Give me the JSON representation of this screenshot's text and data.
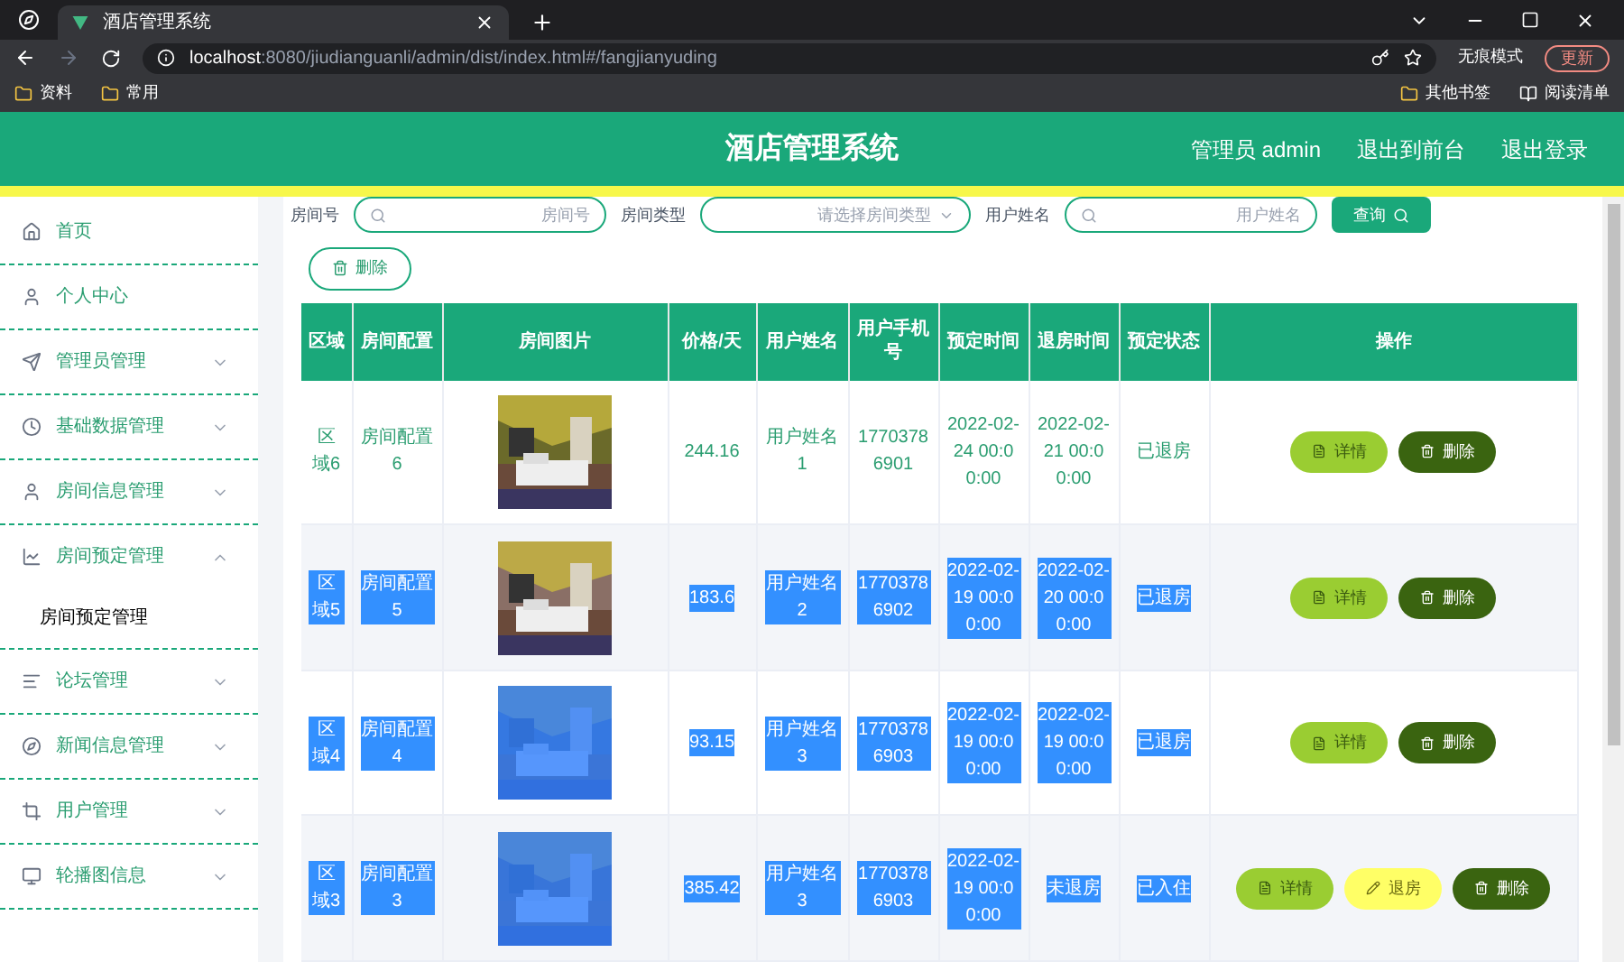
{
  "browser": {
    "tab_title": "酒店管理系统",
    "url_host": "localhost",
    "url_rest": ":8080/jiudianguanli/admin/dist/index.html#/fangjianyuding",
    "profile": "无痕模式",
    "update": "更新",
    "bookmarks_left": [
      "资料",
      "常用"
    ],
    "bookmarks_right": [
      "其他书签",
      "阅读清单"
    ]
  },
  "header": {
    "title": "酒店管理系统",
    "user": "管理员 admin",
    "links": [
      "退出到前台",
      "退出登录"
    ]
  },
  "sidebar": {
    "items": [
      {
        "label": "首页",
        "kind": "link"
      },
      {
        "label": "个人中心",
        "kind": "link"
      },
      {
        "label": "管理员管理",
        "kind": "menu",
        "expanded": false
      },
      {
        "label": "基础数据管理",
        "kind": "menu",
        "expanded": false
      },
      {
        "label": "房间信息管理",
        "kind": "menu",
        "expanded": false
      },
      {
        "label": "房间预定管理",
        "kind": "menu",
        "expanded": true,
        "children": [
          {
            "label": "房间预定管理"
          }
        ]
      },
      {
        "label": "论坛管理",
        "kind": "menu",
        "expanded": false
      },
      {
        "label": "新闻信息管理",
        "kind": "menu",
        "expanded": false
      },
      {
        "label": "用户管理",
        "kind": "menu",
        "expanded": false
      },
      {
        "label": "轮播图信息",
        "kind": "menu",
        "expanded": false
      }
    ]
  },
  "search": {
    "fields": [
      {
        "label": "房间号",
        "placeholder": "房间号",
        "kind": "text"
      },
      {
        "label": "房间类型",
        "placeholder": "请选择房间类型",
        "kind": "select"
      },
      {
        "label": "用户姓名",
        "placeholder": "用户姓名",
        "kind": "text"
      }
    ],
    "button": "查询"
  },
  "delete_button": "删除",
  "table": {
    "columns": [
      "区域",
      "房间配置",
      "房间图片",
      "价格/天",
      "用户姓名",
      "用户手机号",
      "预定时间",
      "退房时间",
      "预定状态",
      "操作"
    ],
    "rows": [
      {
        "highlighted": false,
        "cells": [
          "区域6",
          "房间配置6",
          {
            "kind": "picture"
          },
          "244.16",
          "用户姓名1",
          "17703786901",
          "2022-02-24 00:00:00",
          "2022-02-21 00:00:00",
          "已退房"
        ],
        "actions": [
          {
            "label": "详情",
            "kind": "detail"
          },
          {
            "label": "删除",
            "kind": "delete"
          }
        ]
      },
      {
        "highlighted": true,
        "cells": [
          "区域5",
          "房间配置5",
          {
            "kind": "picture"
          },
          "183.6",
          "用户姓名2",
          "17703786902",
          "2022-02-19 00:00:00",
          "2022-02-20 00:00:00",
          "已退房"
        ],
        "actions": [
          {
            "label": "详情",
            "kind": "detail"
          },
          {
            "label": "删除",
            "kind": "delete"
          }
        ]
      },
      {
        "highlighted": true,
        "cells": [
          "区域4",
          "房间配置4",
          {
            "kind": "picture"
          },
          "93.15",
          "用户姓名3",
          "17703786903",
          "2022-02-19 00:00:00",
          "2022-02-19 00:00:00",
          "已退房"
        ],
        "actions": [
          {
            "label": "详情",
            "kind": "detail"
          },
          {
            "label": "删除",
            "kind": "delete"
          }
        ]
      },
      {
        "highlighted": true,
        "cells": [
          "区域3",
          "房间配置3",
          {
            "kind": "picture"
          },
          "385.42",
          "用户姓名3",
          "17703786903",
          "2022-02-19 00:00:00",
          "未退房",
          "已入住"
        ],
        "actions": [
          {
            "label": "详情",
            "kind": "detail"
          },
          {
            "label": "退房",
            "kind": "checkout"
          },
          {
            "label": "删除",
            "kind": "delete"
          }
        ]
      }
    ]
  }
}
